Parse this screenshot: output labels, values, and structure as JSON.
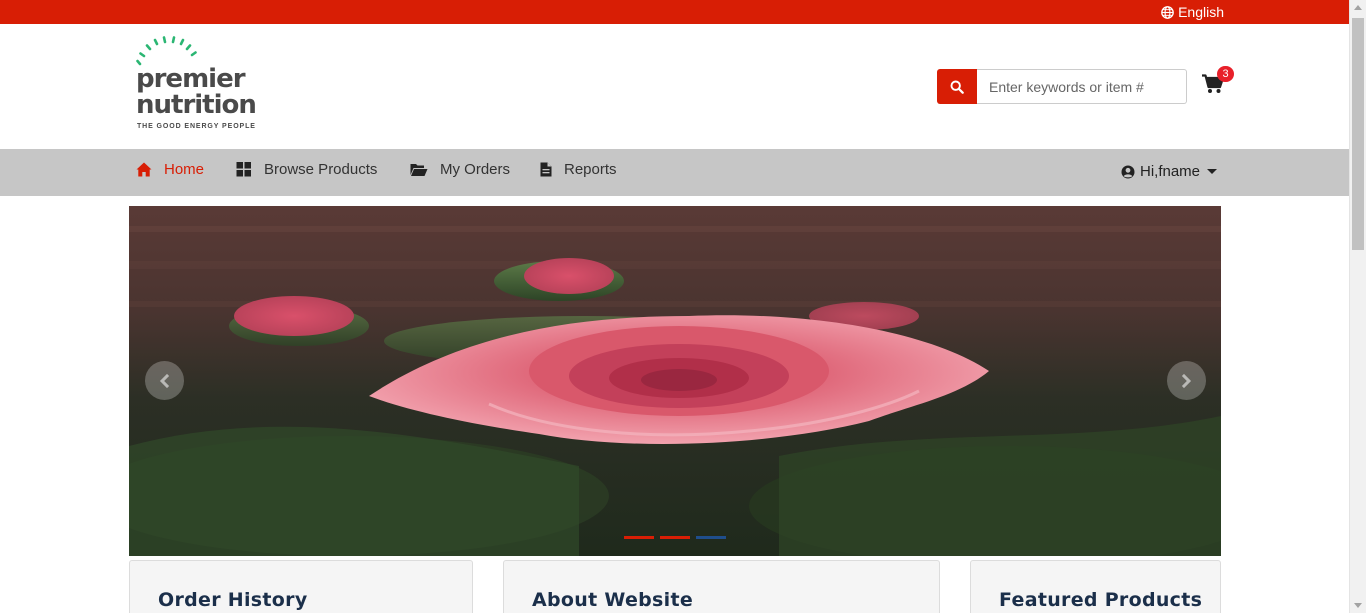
{
  "topbar": {
    "language": "English",
    "bg_color": "#d81e05"
  },
  "logo": {
    "line1": "premier",
    "line2": "nutrition",
    "tagline": "THE GOOD ENERGY PEOPLE",
    "ray_color": "#2bb673"
  },
  "search": {
    "placeholder": "Enter keywords or item #",
    "value": "",
    "icon": "search-icon"
  },
  "cart": {
    "count": "3",
    "icon": "shopping-cart-icon"
  },
  "nav": {
    "items": [
      {
        "label": "Home",
        "icon": "home-icon",
        "active": true
      },
      {
        "label": "Browse Products",
        "icon": "grid-icon",
        "active": false
      },
      {
        "label": "My Orders",
        "icon": "folder-open-icon",
        "active": false
      },
      {
        "label": "Reports",
        "icon": "file-icon",
        "active": false
      }
    ],
    "user_label": "Hi,fname",
    "accent_color": "#d81e05"
  },
  "carousel": {
    "slides": 3,
    "active_index": 0,
    "indicator_colors": [
      "#d81e05",
      "#d81e05",
      "#1f4e8c"
    ]
  },
  "cards": [
    {
      "title": "Order History"
    },
    {
      "title": "About Website"
    },
    {
      "title": "Featured Products"
    }
  ]
}
